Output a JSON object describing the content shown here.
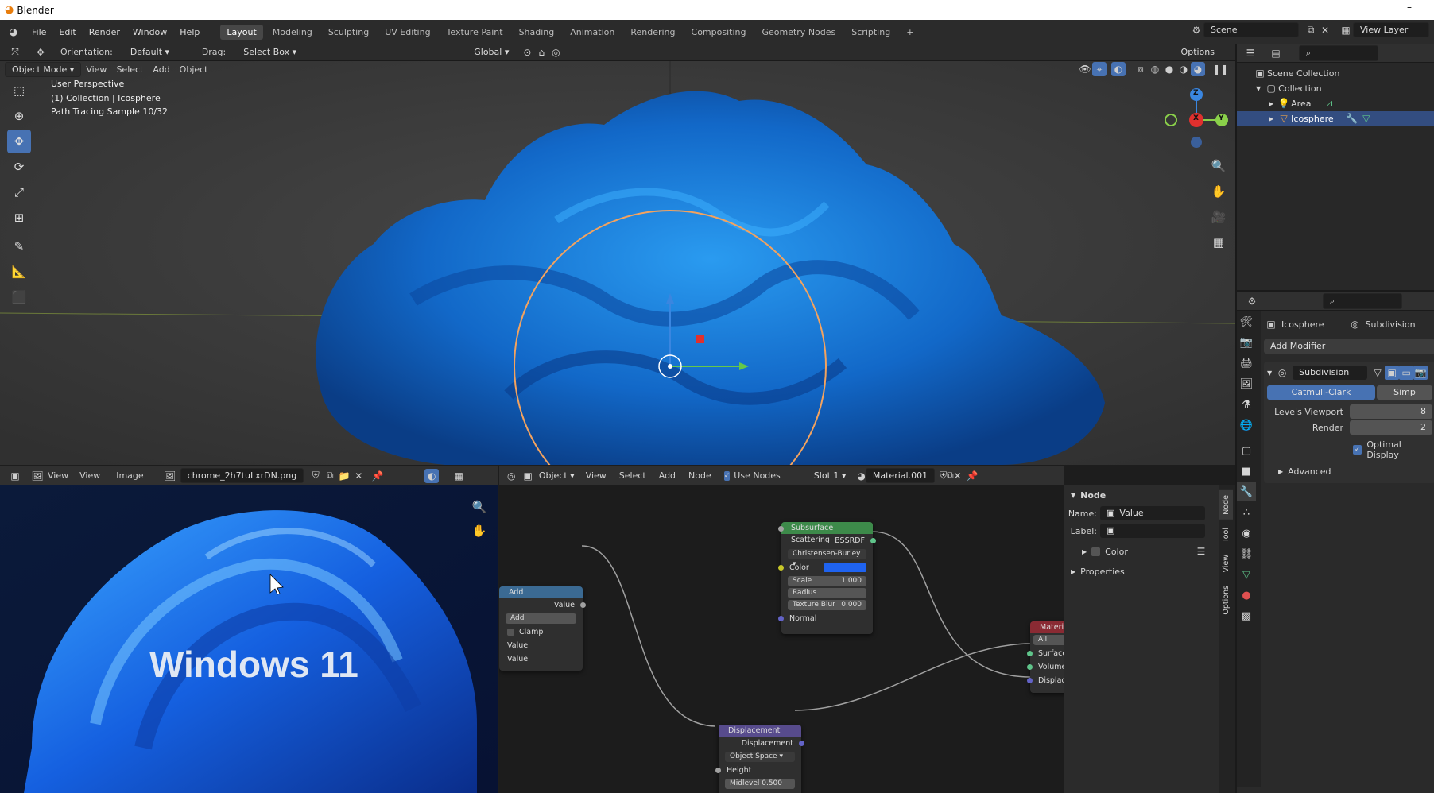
{
  "window": {
    "title": "Blender",
    "minimize_glyph": "–"
  },
  "menu": [
    "File",
    "Edit",
    "Render",
    "Window",
    "Help"
  ],
  "workspaces": [
    "Layout",
    "Modeling",
    "Sculpting",
    "UV Editing",
    "Texture Paint",
    "Shading",
    "Animation",
    "Rendering",
    "Compositing",
    "Geometry Nodes",
    "Scripting"
  ],
  "active_workspace": "Layout",
  "add_workspace": "+",
  "scene": {
    "name": "Scene",
    "view_layer": "View Layer"
  },
  "tool_header": {
    "orientation_label": "Orientation:",
    "orientation_value": "Default",
    "drag_label": "Drag:",
    "drag_value": "Select Box",
    "transform": "Global",
    "options": "Options"
  },
  "viewport": {
    "mode": "Object Mode",
    "menus": [
      "View",
      "Select",
      "Add",
      "Object"
    ],
    "overlay_lines": [
      "User Perspective",
      "(1) Collection | Icosphere",
      "Path Tracing Sample 10/32"
    ],
    "gizmo": {
      "z": "Z",
      "x": "X",
      "y": "Y"
    }
  },
  "outliner": {
    "scene_collection": "Scene Collection",
    "collection": "Collection",
    "items": [
      "Area",
      "Icosphere"
    ]
  },
  "properties": {
    "object_name": "Icosphere",
    "modifier_tab": "Subdivision",
    "add_modifier": "Add Modifier",
    "modifier_name": "Subdivision",
    "catmull_clark": "Catmull-Clark",
    "simple": "Simp",
    "levels_viewport_label": "Levels Viewport",
    "levels_viewport_value": "8",
    "render_label": "Render",
    "render_value": "2",
    "optimal_display": "Optimal Display",
    "advanced": "Advanced"
  },
  "image_editor": {
    "view_menu": "View",
    "menus": [
      "View",
      "Image"
    ],
    "image_name": "chrome_2h7tuLxrDN.png",
    "wallpaper_text": "Windows 11"
  },
  "node_editor": {
    "object_type": "Object",
    "menus": [
      "View",
      "Select",
      "Add",
      "Node"
    ],
    "use_nodes": "Use Nodes",
    "slot": "Slot 1",
    "material": "Material.001"
  },
  "node_sidebar": {
    "section": "Node",
    "name_label": "Name:",
    "name_value": "Value",
    "label_label": "Label:",
    "color": "Color",
    "properties": "Properties",
    "tabs": [
      "Node",
      "Tool",
      "View",
      "Options"
    ]
  },
  "nodes": {
    "sss": {
      "title": "Subsurface Scattering",
      "output": "BSSRDF",
      "method": "Christensen-Burley",
      "color": "Color",
      "scale_label": "Scale",
      "scale_value": "1.000",
      "radius": "Radius",
      "blur_label": "Texture Blur",
      "blur_value": "0.000",
      "normal": "Normal",
      "color_swatch": "#1f63f0"
    },
    "add": {
      "title": "Add",
      "output": "Value",
      "op": "Add",
      "clamp": "Clamp",
      "in1": "Value",
      "in2": "Value"
    },
    "material_out": {
      "title": "Materi",
      "target": "All",
      "surface": "Surface",
      "volume": "Volume",
      "displacement": "Displacer"
    },
    "displacement": {
      "title": "Displacement",
      "output": "Displacement",
      "space": "Object Space",
      "height": "Height",
      "midlevel": "Midlevel  0.500"
    }
  },
  "colors": {
    "accent": "#4772b3",
    "header": "#303030",
    "bg": "#1d1d1d",
    "shader_green": "#3d8a4a",
    "converter_blue": "#3b6a93",
    "vector_purple": "#574b8c",
    "output_red": "#8a2a33"
  }
}
